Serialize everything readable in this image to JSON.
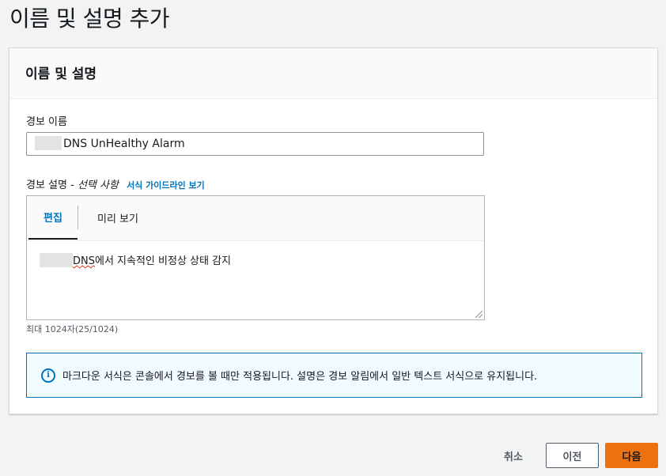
{
  "page": {
    "title": "이름 및 설명 추가"
  },
  "card": {
    "title": "이름 및 설명"
  },
  "name_field": {
    "label": "경보 이름",
    "value": "DNS UnHealthy Alarm"
  },
  "description_field": {
    "label": "경보 설명 - ",
    "optional": "선택 사항",
    "guide_link": "서식 가이드라인 보기",
    "tabs": [
      "편집",
      "미리 보기"
    ],
    "active_tab": "편집",
    "value_prefix": "DNS",
    "value_rest": "에서 지속적인 비정상 상태 감지",
    "char_count": "최대 1024자(25/1024)"
  },
  "info_alert": {
    "icon": "info-icon",
    "text": "마크다운 서식은 콘솔에서 경보를 볼 때만 적용됩니다. 설명은 경보 알림에서 일반 텍스트 서식으로 유지됩니다."
  },
  "footer": {
    "cancel": "취소",
    "previous": "이전",
    "next": "다음"
  },
  "colors": {
    "accent": "#0073bb",
    "primary_button": "#ec7211",
    "background": "#f2f3f3"
  }
}
